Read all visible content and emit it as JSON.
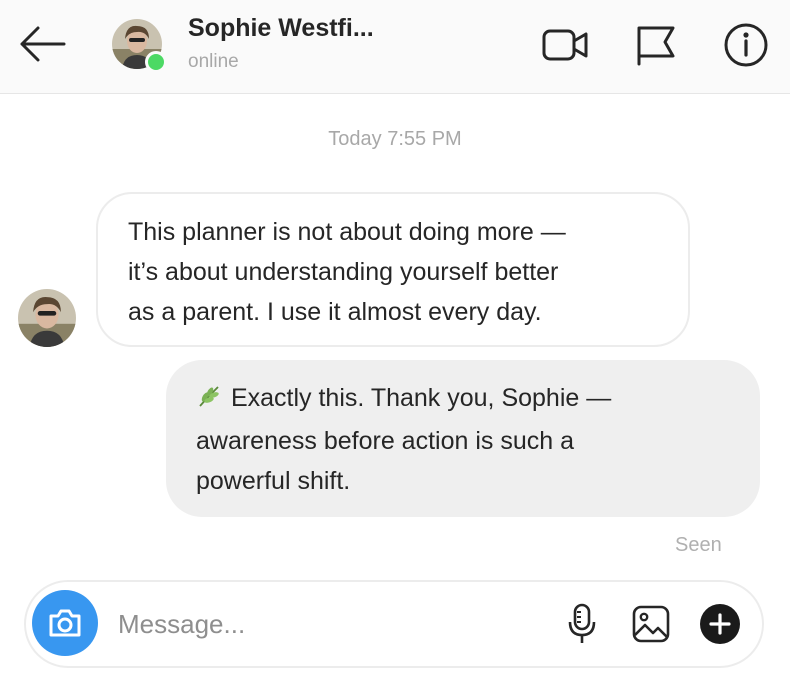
{
  "header": {
    "contact_name": "Sophie Westfi...",
    "status": "online",
    "icons": [
      "back-arrow-icon",
      "video-camera-icon",
      "flag-icon",
      "info-icon"
    ]
  },
  "conversation": {
    "timestamp": "Today 7:55 PM",
    "messages": [
      {
        "direction": "incoming",
        "text": "This planner is not about doing more —\nit’s about understanding yourself better\nas a parent. I use it almost every day."
      },
      {
        "direction": "outgoing",
        "emoji": "herb-icon",
        "text": "Exactly this. Thank you, Sophie —\nawareness before action is such a\npowerful shift."
      }
    ],
    "seen_label": "Seen"
  },
  "composer": {
    "placeholder": "Message...",
    "value": "",
    "icons": [
      "camera-icon",
      "microphone-icon",
      "image-icon",
      "plus-circle-icon"
    ]
  },
  "colors": {
    "online": "#4cd964",
    "camera_button": "#3897f0",
    "outgoing_bubble": "#efefef",
    "muted_text": "#a8a8a8"
  }
}
